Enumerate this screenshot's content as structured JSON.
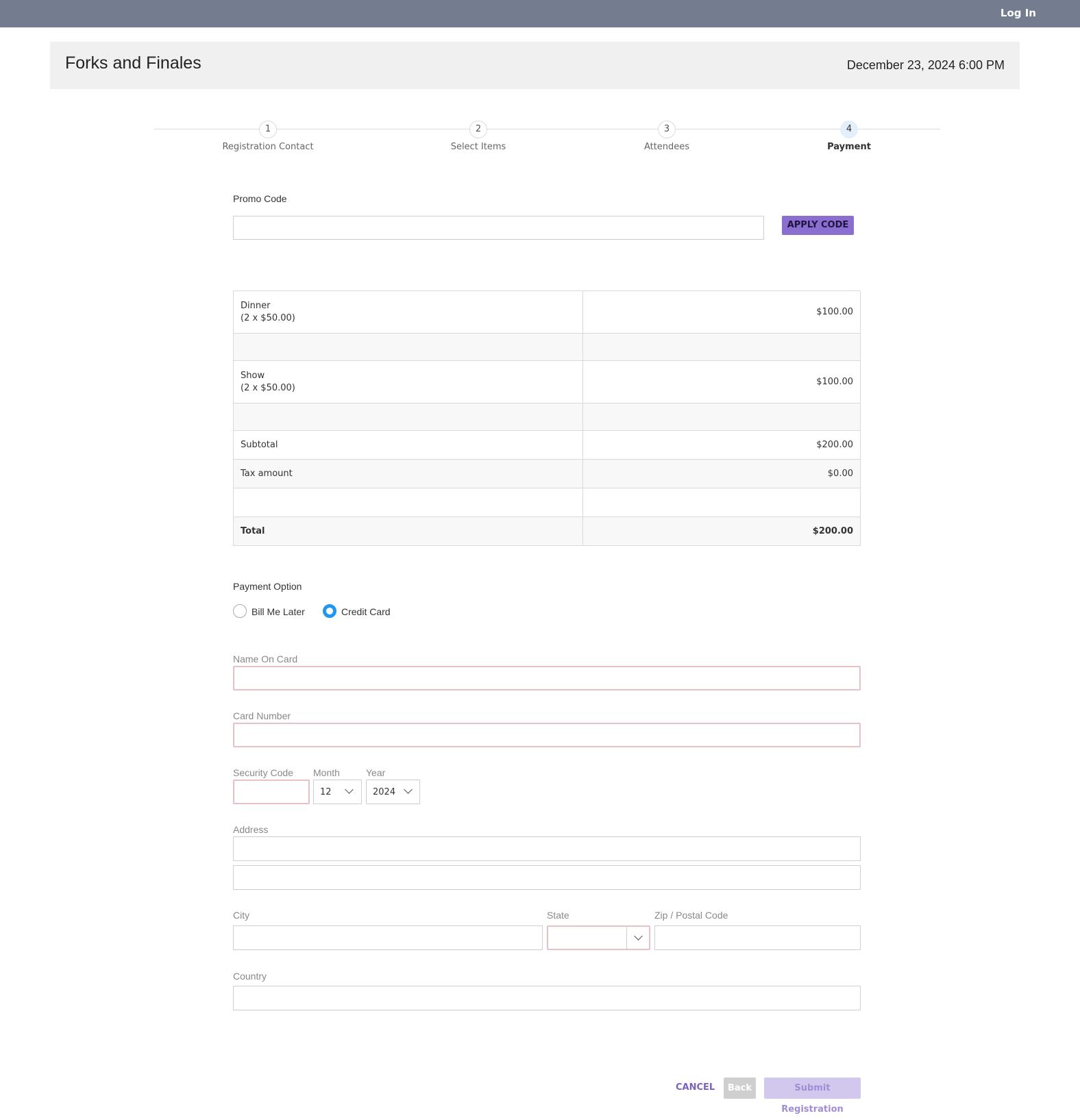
{
  "topbar": {
    "login_label": "Log In"
  },
  "event": {
    "title": "Forks and Finales",
    "datetime": "December 23, 2024 6:00 PM"
  },
  "steps": [
    {
      "number": "1",
      "label": "Registration Contact",
      "active": false
    },
    {
      "number": "2",
      "label": "Select Items",
      "active": false
    },
    {
      "number": "3",
      "label": "Attendees",
      "active": false
    },
    {
      "number": "4",
      "label": "Payment",
      "active": true
    }
  ],
  "promo": {
    "label": "Promo Code",
    "value": "",
    "apply_label": "APPLY CODE"
  },
  "summary": {
    "items": [
      {
        "name": "Dinner",
        "detail": "(2 x $50.00)",
        "amount": "$100.00"
      },
      {
        "name": "Show",
        "detail": "(2 x $50.00)",
        "amount": "$100.00"
      }
    ],
    "subtotal_label": "Subtotal",
    "subtotal": "$200.00",
    "tax_label": "Tax amount",
    "tax": "$0.00",
    "total_label": "Total",
    "total": "$200.00"
  },
  "payment": {
    "label": "Payment Option",
    "options": [
      "Bill Me Later",
      "Credit Card"
    ],
    "selected": "Credit Card"
  },
  "card": {
    "name_label": "Name On Card",
    "name_value": "",
    "number_label": "Card Number",
    "number_value": "",
    "security_label": "Security Code",
    "security_value": "",
    "month_label": "Month",
    "month_value": "12",
    "year_label": "Year",
    "year_value": "2024"
  },
  "address": {
    "label": "Address",
    "line1": "",
    "line2": "",
    "city_label": "City",
    "city_value": "",
    "state_label": "State",
    "state_value": "",
    "zip_label": "Zip / Postal Code",
    "zip_value": "",
    "country_label": "Country",
    "country_value": ""
  },
  "actions": {
    "cancel_label": "CANCEL",
    "back_label": "Back",
    "submit_label": "Submit Registration"
  },
  "colors": {
    "topbar": "#737d8f",
    "accent": "#8a6fd0",
    "radio_selected": "#2196f3",
    "invalid_border": "#e7c1c6"
  }
}
